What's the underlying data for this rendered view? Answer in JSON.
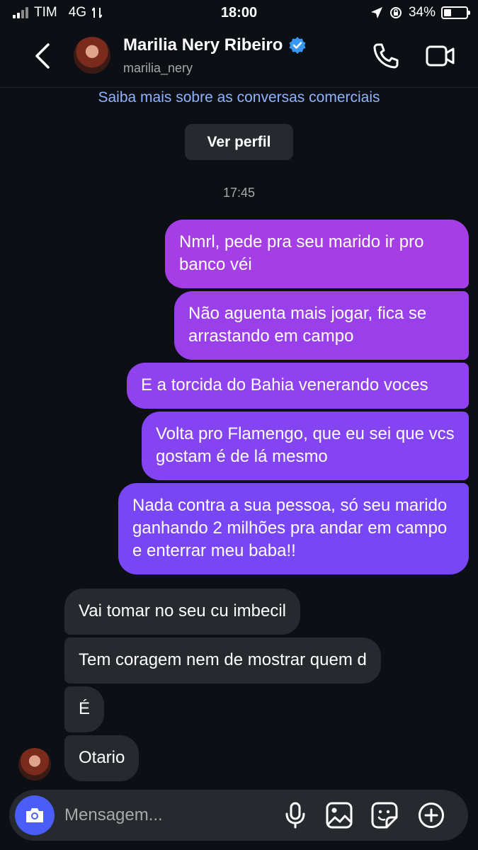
{
  "status_bar": {
    "carrier": "TIM",
    "network": "4G",
    "time": "18:00",
    "battery_text": "34%",
    "battery_level": 0.34
  },
  "header": {
    "contact_name": "Marilia Nery Ribeiro",
    "contact_handle": "marilia_nery",
    "verified": true,
    "icons": [
      "back-icon",
      "phone-icon",
      "video-icon"
    ]
  },
  "info": {
    "business_link": "Saiba mais sobre as conversas comerciais",
    "view_profile_label": "Ver perfil",
    "timestamp": "17:45"
  },
  "messages_sent": [
    {
      "text": "Nmrl, pede pra seu marido ir pro banco véi"
    },
    {
      "text": "Não aguenta mais jogar, fica se arrastando em campo"
    },
    {
      "text": "E a torcida do Bahia venerando voces"
    },
    {
      "text": "Volta pro Flamengo, que eu sei que vcs gostam é de lá mesmo"
    },
    {
      "text": "Nada contra a sua pessoa, só seu marido ganhando 2 milhões pra andar em campo e enterrar meu baba!!"
    }
  ],
  "messages_received": [
    {
      "text": "Vai tomar no seu cu imbecil"
    },
    {
      "text": "Tem coragem nem de mostrar quem d"
    },
    {
      "text": "É"
    },
    {
      "text": "Otario"
    }
  ],
  "composer": {
    "placeholder": "Mensagem...",
    "icons": [
      "camera-icon",
      "microphone-icon",
      "image-icon",
      "sticker-icon",
      "plus-icon"
    ]
  },
  "colors": {
    "background": "#0c1014",
    "sent_bubble_top": "#a63ee6",
    "sent_bubble_bottom": "#7846f4",
    "received_bubble": "#26292d",
    "link": "#8fb3ff",
    "camera_button": "#4a5ef7"
  }
}
